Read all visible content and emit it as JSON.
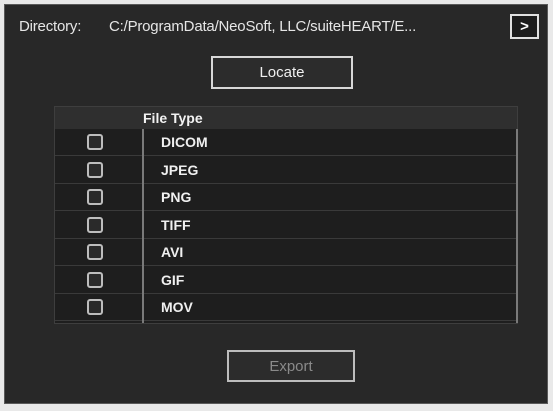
{
  "directory": {
    "label": "Directory:",
    "path": "C:/ProgramData/NeoSoft, LLC/suiteHEART/E...",
    "next_label": ">"
  },
  "buttons": {
    "locate_label": "Locate",
    "export_label": "Export",
    "export_enabled": false
  },
  "table": {
    "header": "File Type",
    "rows": [
      {
        "label": "DICOM",
        "checked": false
      },
      {
        "label": "JPEG",
        "checked": false
      },
      {
        "label": "PNG",
        "checked": false
      },
      {
        "label": "TIFF",
        "checked": false
      },
      {
        "label": "AVI",
        "checked": false
      },
      {
        "label": "GIF",
        "checked": false
      },
      {
        "label": "MOV",
        "checked": false
      }
    ]
  },
  "colors": {
    "panel_bg": "#282828",
    "table_bg": "#1e1e1e",
    "text": "#f0f0f0",
    "disabled_text": "#8a8a8a"
  }
}
